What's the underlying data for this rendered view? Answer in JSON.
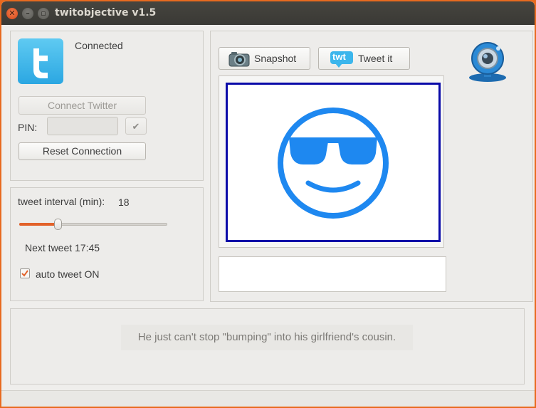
{
  "window": {
    "title": "twitobjective v1.5",
    "close_glyph": "✕",
    "min_glyph": "–",
    "max_glyph": "▫"
  },
  "account": {
    "status": "Connected",
    "connect_label": "Connect Twitter",
    "pin_label": "PIN:",
    "pin_value": "",
    "confirm_glyph": "✔",
    "reset_label": "Reset Connection"
  },
  "schedule": {
    "interval_label": "tweet interval (min):",
    "interval_value": "18",
    "slider_fraction": 0.25,
    "next_tweet": "Next tweet 17:45",
    "auto_tweet_label": "auto tweet ON",
    "auto_tweet_checked": true
  },
  "camera": {
    "snapshot_label": "Snapshot",
    "tweet_label": "Tweet it",
    "twt_logo_text": "twt",
    "caption_value": ""
  },
  "message": {
    "text": "He just can't stop \"bumping\" into his girlfriend's cousin."
  },
  "colors": {
    "accent": "#e86a1f",
    "twitter_blue": "#34b5e8",
    "smiley_blue": "#1e88f0",
    "frame_blue": "#0a0aa8"
  }
}
